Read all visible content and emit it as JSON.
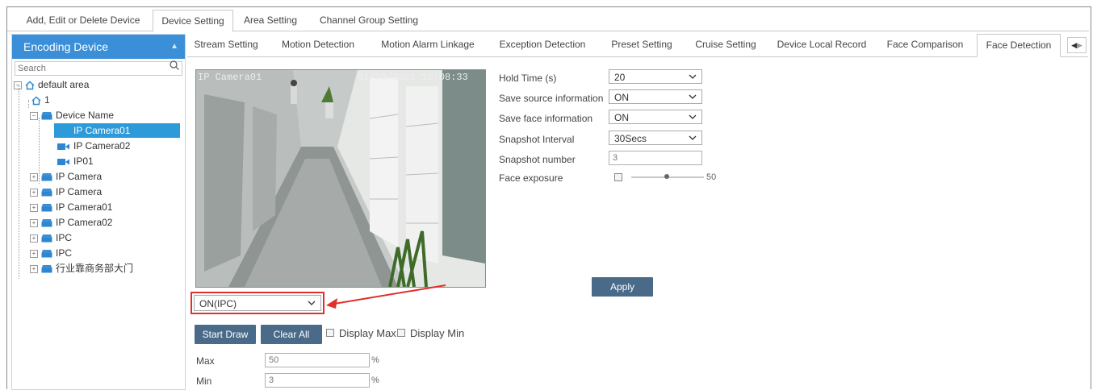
{
  "top_tabs": [
    "Add, Edit or Delete Device",
    "Device Setting",
    "Area Setting",
    "Channel Group Setting"
  ],
  "left_panel": {
    "title": "Encoding Device",
    "search_placeholder": "Search",
    "tree": {
      "root": "default area",
      "area_child": "1",
      "device_name": "Device Name",
      "cameras": [
        "IP Camera01",
        "IP Camera02",
        "IP01"
      ],
      "groups": [
        "IP Camera",
        "IP Camera",
        "IP Camera01",
        "IP Camera02",
        "IPC",
        "IPC",
        "行业靠商务部大门"
      ]
    }
  },
  "sub_tabs": [
    "Stream Setting",
    "Motion Detection",
    "Motion Alarm Linkage",
    "Exception Detection",
    "Preset Setting",
    "Cruise Setting",
    "Device Local Record",
    "Face Comparison",
    "Face Detection"
  ],
  "video": {
    "osd_name": "IP Camera01",
    "osd_time": "01/26/2021 10:08:33"
  },
  "form": {
    "hold_time": {
      "label": "Hold Time (s)",
      "value": "20"
    },
    "save_source": {
      "label": "Save source information",
      "value": "ON"
    },
    "save_face": {
      "label": "Save face information",
      "value": "ON"
    },
    "snapshot_interval": {
      "label": "Snapshot Interval",
      "value": "30Secs"
    },
    "snapshot_number": {
      "label": "Snapshot number",
      "value": "3"
    },
    "face_exposure": {
      "label": "Face exposure",
      "value": "50",
      "checked": false
    }
  },
  "apply_label": "Apply",
  "detect_mode": "ON(IPC)",
  "draw": {
    "start_draw": "Start Draw",
    "clear_all": "Clear All",
    "display_max": "Display Max",
    "display_min": "Display Min"
  },
  "limits": {
    "max_label": "Max",
    "max_value": "50",
    "min_label": "Min",
    "min_value": "3",
    "unit": "%"
  },
  "colors": {
    "accent": "#3a8fd8",
    "selected": "#2d9ad9",
    "button": "#4a6a89",
    "highlight": "#e0302a"
  }
}
